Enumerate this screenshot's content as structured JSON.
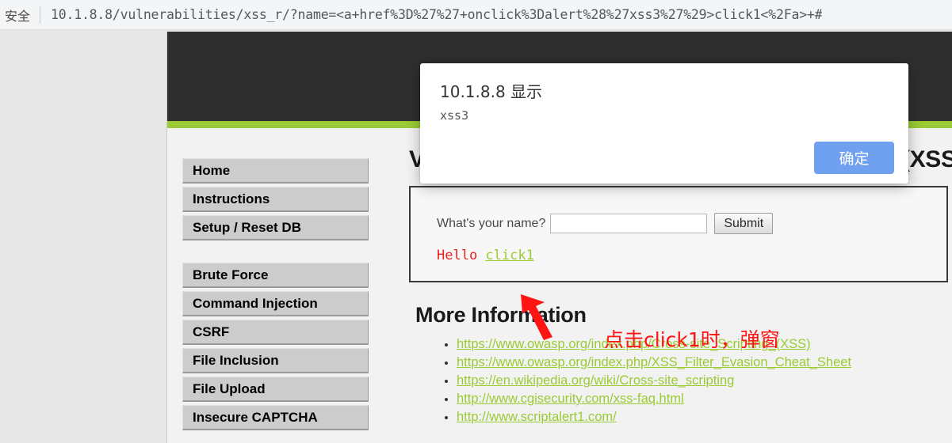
{
  "browser": {
    "security_label": "安全",
    "url": "10.1.8.8/vulnerabilities/xss_r/?name=<a+href%3D%27%27+onclick%3Dalert%28%27xss3%27%29>click1<%2Fa>+#"
  },
  "dialog": {
    "title": "10.1.8.8 显示",
    "message": "xss3",
    "ok_label": "确定",
    "button_color": "#6fa1f0"
  },
  "sidebar": {
    "groups": [
      {
        "items": [
          {
            "label": "Home"
          },
          {
            "label": "Instructions"
          },
          {
            "label": "Setup / Reset DB"
          }
        ]
      },
      {
        "items": [
          {
            "label": "Brute Force"
          },
          {
            "label": "Command Injection"
          },
          {
            "label": "CSRF"
          },
          {
            "label": "File Inclusion"
          },
          {
            "label": "File Upload"
          },
          {
            "label": "Insecure CAPTCHA"
          }
        ]
      }
    ]
  },
  "main": {
    "heading": "Vulnerability: Reflected Cross Site Scripting (XSS)",
    "form": {
      "label": "What's your name?",
      "input_value": "",
      "input_placeholder": "",
      "submit_label": "Submit"
    },
    "greeting": {
      "prefix": "Hello ",
      "link_text": "click1",
      "prefix_color": "#ef2020",
      "link_color": "#9bcb34"
    },
    "more_information_heading": "More Information",
    "links": [
      "https://www.owasp.org/index.php/Cross-site_Scripting_(XSS)",
      "https://www.owasp.org/index.php/XSS_Filter_Evasion_Cheat_Sheet",
      "https://en.wikipedia.org/wiki/Cross-site_scripting",
      "http://www.cgisecurity.com/xss-faq.html",
      "http://www.scriptalert1.com/"
    ]
  },
  "annotation": {
    "text": "点击click1时，弹窗",
    "color": "#ff1414"
  },
  "theme": {
    "header_dark": "#2e2e2e",
    "accent_green": "#9bcb34",
    "nav_button_bg": "#cccccc"
  }
}
